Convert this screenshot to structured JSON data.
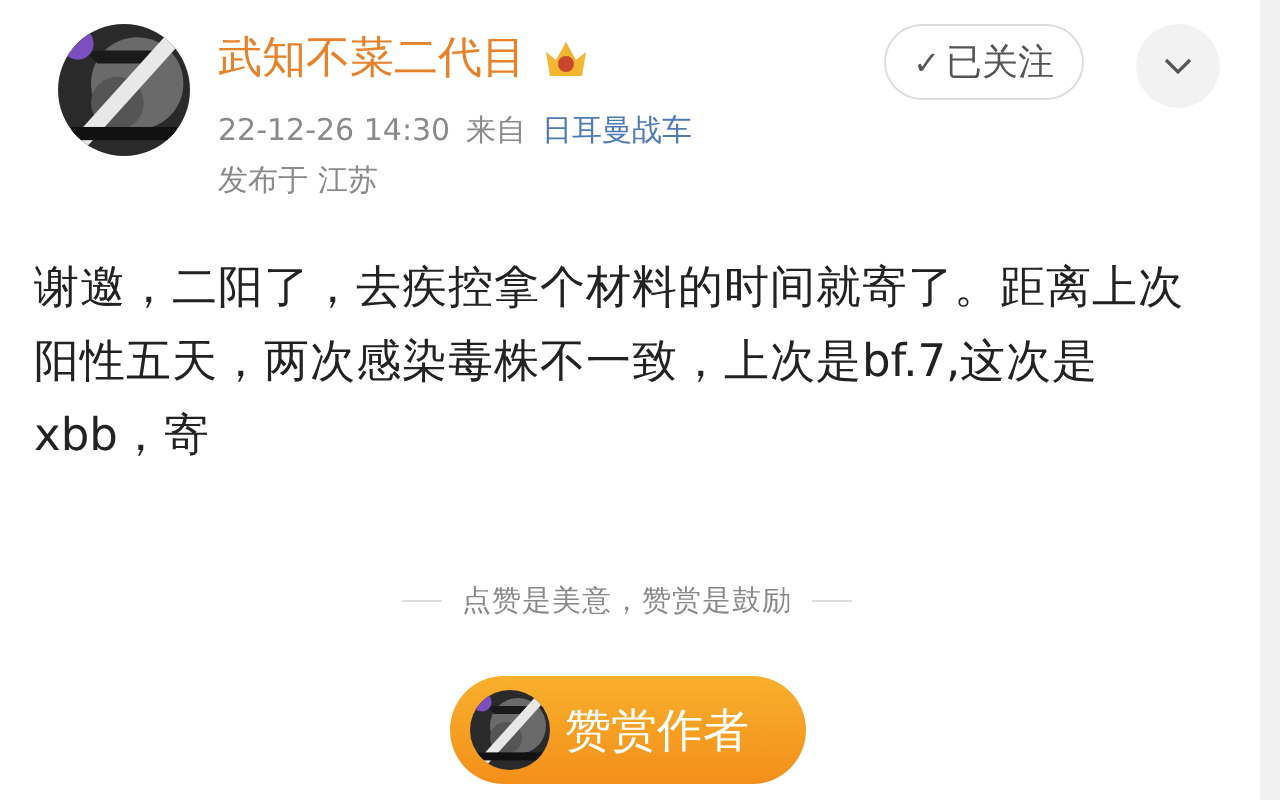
{
  "post": {
    "author": "武知不菜二代目",
    "timestamp": "22-12-26 14:30",
    "source_prefix": "来自",
    "source": "日耳曼战车",
    "location": "发布于 江苏",
    "follow_button": {
      "icon": "✓",
      "label": "已关注"
    },
    "text": "谢邀，二阳了，去疾控拿个材料的时间就寄了。距离上次阳性五天，两次感染毒株不一致，上次是bf.7,这次是xbb，寄"
  },
  "reward": {
    "caption": "点赞是美意，赞赏是鼓励",
    "button": "赞赏作者"
  }
}
